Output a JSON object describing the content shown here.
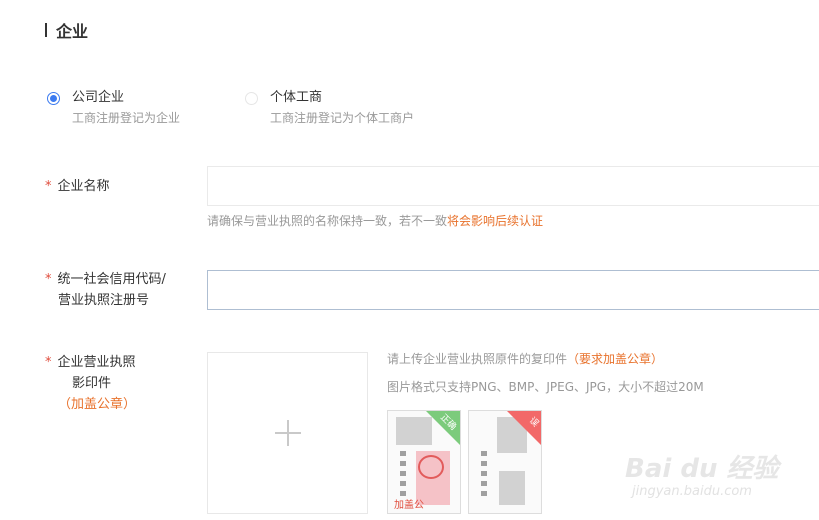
{
  "section": {
    "title": "企业"
  },
  "entity_types": [
    {
      "label": "公司企业",
      "desc": "工商注册登记为企业",
      "selected": true
    },
    {
      "label": "个体工商",
      "desc": "工商注册登记为个体工商户",
      "selected": false
    }
  ],
  "form": {
    "required_mark": "*",
    "company_name": {
      "label": "企业名称",
      "value": "",
      "hint_prefix": "请确保与营业执照的名称保持一致，若不一致",
      "hint_warning": "将会影响后续认证"
    },
    "credit_code": {
      "label_line1": "统一社会信用代码/",
      "label_line2": "营业执照注册号",
      "value": ""
    },
    "license_copy": {
      "label_line1": "企业营业执照",
      "label_line2": "影印件",
      "label_note": "（加盖公章）",
      "upload_plus": "+",
      "info_prefix": "请上传企业营业执照原件的复印件",
      "info_warning": "（要求加盖公章）",
      "format_note": "图片格式只支持PNG、BMP、JPEG、JPG，大小不超过20M",
      "sample_correct_tag": "正确",
      "sample_wrong_tag": "误",
      "sample_caption": "加盖公"
    }
  },
  "watermark": {
    "logo": "Bai du 经验",
    "url": "jingyan.baidu.com"
  },
  "colors": {
    "accent": "#3c7bf0",
    "warning": "#e8722c",
    "required": "#e04c3c"
  }
}
